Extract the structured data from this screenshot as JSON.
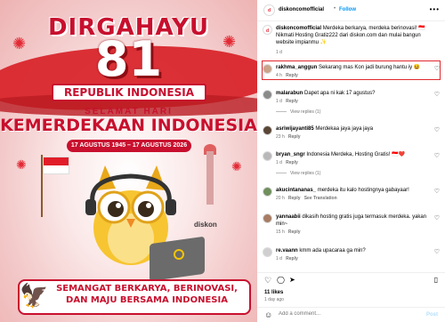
{
  "post_image": {
    "title_top": "DIRGAHAYU",
    "title_number": "81",
    "ribbon": "REPUBLIK INDONESIA",
    "subtitle_small": "SELAMAT HARI",
    "subtitle_big": "KEMERDEKAAN INDONESIA",
    "date_range": "17 AGUSTUS 1945 – 17 AGUSTUS 2026",
    "brand": "diskon",
    "bottom_text": "SEMANGAT BERKARYA, BERINOVASI, DAN MAJU BERSAMA INDONESIA",
    "colors": {
      "red": "#c8102e",
      "white": "#ffffff"
    }
  },
  "header": {
    "username": "diskoncomofficial",
    "separator": "•",
    "follow_label": "Follow",
    "more_icon": "more-horizontal-icon"
  },
  "caption": {
    "username": "diskoncomofficial",
    "text": "Merdeka berkarya, merdeka berinovasi! 🇮🇩 Nikmati Hosting Gratiz222 dari diskon.com dan mulai bangun website impianmu ✨",
    "age": "1 d"
  },
  "comments": [
    {
      "username": "rakhma_anggun",
      "text": "Sekarang mas Kon jadi burung hantu iy 😆",
      "age": "4 h",
      "reply": "Reply",
      "highlighted": true
    },
    {
      "username": "malarabun",
      "text": "Dapet apa ni kak 17 agustus?",
      "age": "1 d",
      "reply": "Reply",
      "view_replies": "View replies (1)"
    },
    {
      "username": "asriwijayanti85",
      "text": "Merdekaa jaya jaya jaya",
      "age": "23 h",
      "reply": "Reply"
    },
    {
      "username": "bryan_sngr",
      "text": "Indonesia Merdeka, Hosting Gratis! 🇮🇩❤️",
      "age": "1 d",
      "reply": "Reply",
      "view_replies": "View replies (1)"
    },
    {
      "username": "akucintananas_",
      "text": "merdeka itu kalo hostingnya gabayaar!",
      "age": "20 h",
      "reply": "Reply",
      "see_translation": "See Translation"
    },
    {
      "username": "yannaabii",
      "text": "dikasih hosting gratis juga termasuk merdeka. yakan min~",
      "age": "15 h",
      "reply": "Reply"
    },
    {
      "username": "re.vaann",
      "text": "kmm ada upacaraa ga min?",
      "age": "1 d",
      "reply": "Reply"
    }
  ],
  "footer": {
    "likes": "11 likes",
    "posted_ago": "1 day ago",
    "add_comment_placeholder": "Add a comment...",
    "post_label": "Post",
    "emoji_icon": "smiley-icon"
  }
}
